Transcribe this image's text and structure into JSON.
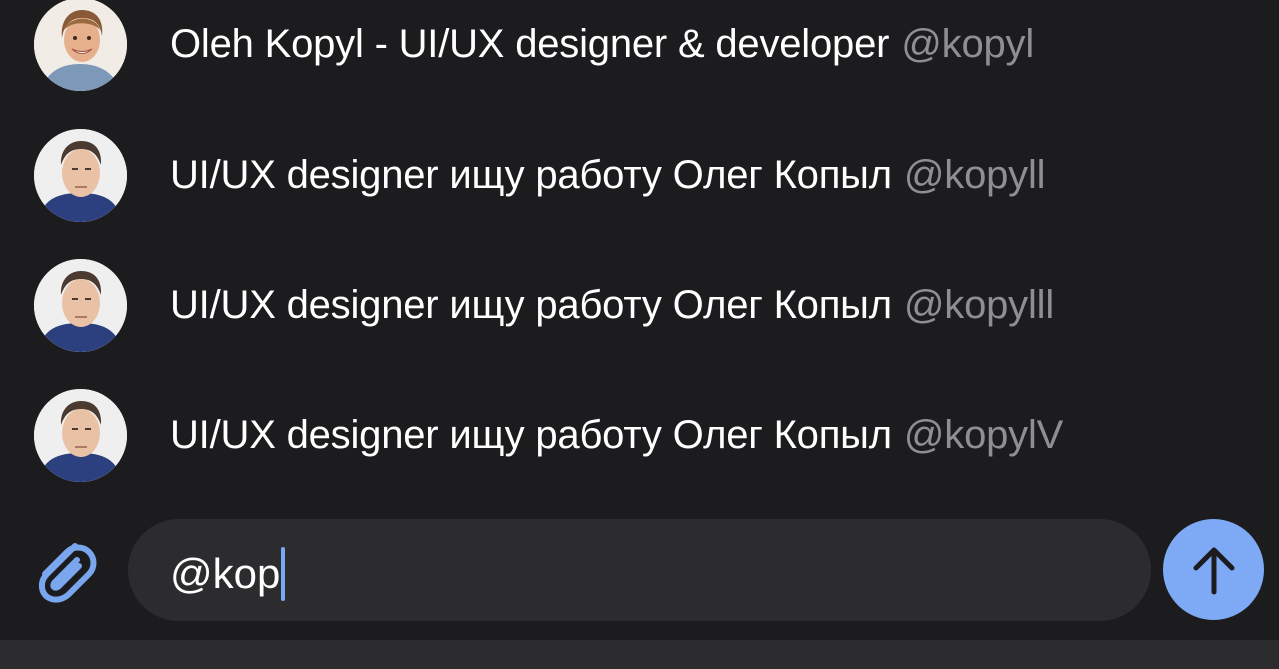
{
  "mentions": [
    {
      "name": "Oleh Kopyl - UI/UX designer & developer",
      "handle": "@kopyl",
      "avatar": "avatar-smiling"
    },
    {
      "name": "UI/UX designer ищу работу Олег Копыл",
      "handle": "@kopyll",
      "avatar": "avatar-portrait"
    },
    {
      "name": "UI/UX designer ищу работу Олег Копыл",
      "handle": "@kopylll",
      "avatar": "avatar-portrait"
    },
    {
      "name": "UI/UX designer ищу работу Олег Копыл",
      "handle": "@kopylV",
      "avatar": "avatar-portrait"
    }
  ],
  "composer": {
    "input_value": "@kop",
    "attach_icon": "paperclip-icon",
    "send_icon": "arrow-up-icon"
  },
  "colors": {
    "background": "#1c1c1e",
    "input_background": "#2c2c2e",
    "accent": "#7ea9f5",
    "handle_text": "#8e8e93",
    "primary_text": "#ffffff"
  }
}
